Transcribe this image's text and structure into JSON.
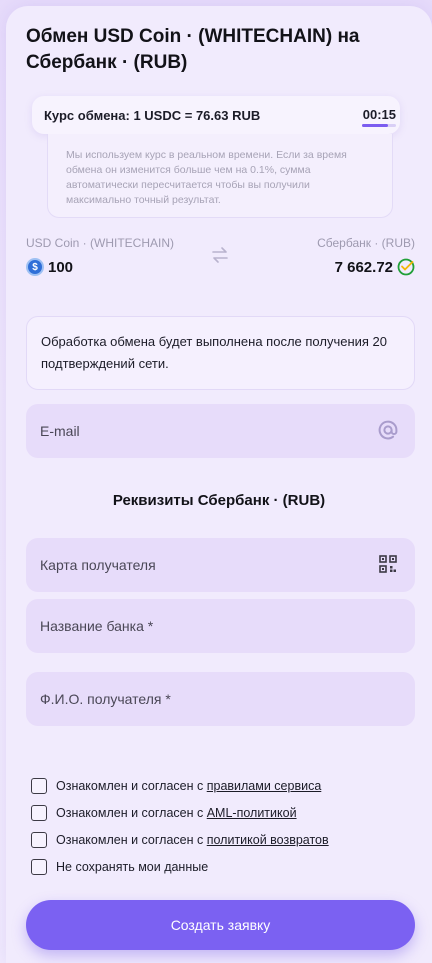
{
  "header": {
    "title": "Обмен USD Coin · (WHITECHAIN) на Сбербанк · (RUB)"
  },
  "rate": {
    "text": "Курс обмена: 1 USDC = 76.63 RUB",
    "timer": "00:15",
    "timer_progress": 0.75,
    "note": "Мы используем курс в реальном времени. Если за время обмена он изменится больше чем на 0.1%, сумма автоматически пересчитается чтобы вы получили максимально точный результат."
  },
  "exchange": {
    "from_label": "USD Coin · (WHITECHAIN)",
    "from_amount": "100",
    "from_icon": "usdc-coin-icon",
    "to_label": "Сбербанк · (RUB)",
    "to_amount": "7 662.72",
    "to_icon": "sberbank-icon"
  },
  "notice": "Обработка обмена будет выполнена после получения 20 подтверждений сети.",
  "email_field": {
    "placeholder": "E-mail",
    "icon": "at-icon"
  },
  "requisites": {
    "title": "Реквизиты Сбербанк · (RUB)",
    "card_placeholder": "Карта получателя",
    "card_icon": "qr-code-icon",
    "bank_placeholder": "Название банка *",
    "name_placeholder": "Ф.И.О. получателя *"
  },
  "agreements": {
    "rules_prefix": "Ознакомлен и согласен с ",
    "rules_link": "правилами сервиса",
    "aml_prefix": "Ознакомлен и согласен с ",
    "aml_link": "AML-политикой",
    "refund_prefix": "Ознакомлен и согласен с ",
    "refund_link": "политикой возвратов",
    "no_save": "Не сохранять мои данные"
  },
  "submit_label": "Создать заявку",
  "colors": {
    "accent": "#7b61f2",
    "field_bg": "#e7dcfa",
    "background": "#f1ebfd"
  }
}
